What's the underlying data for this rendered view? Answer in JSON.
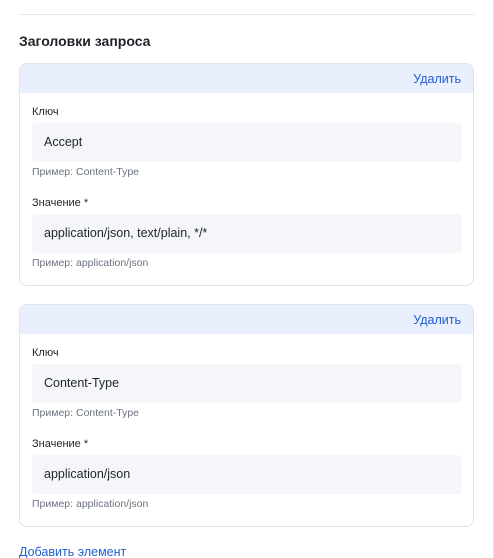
{
  "section": {
    "title": "Заголовки запроса"
  },
  "headers": [
    {
      "delete_label": "Удалить",
      "key_label": "Ключ",
      "key_value": "Accept",
      "key_hint": "Пример: Content-Type",
      "value_label": "Значение *",
      "value_value": "application/json, text/plain, */*",
      "value_hint": "Пример: application/json"
    },
    {
      "delete_label": "Удалить",
      "key_label": "Ключ",
      "key_value": "Content-Type",
      "key_hint": "Пример: Content-Type",
      "value_label": "Значение *",
      "value_value": "application/json",
      "value_hint": "Пример: application/json"
    }
  ],
  "add_label": "Добавить элемент",
  "colors": {
    "accent": "#1f5fd1",
    "card_header_bg": "#e9effc",
    "input_bg": "#f4f6fa",
    "border": "#dfe3e8"
  }
}
